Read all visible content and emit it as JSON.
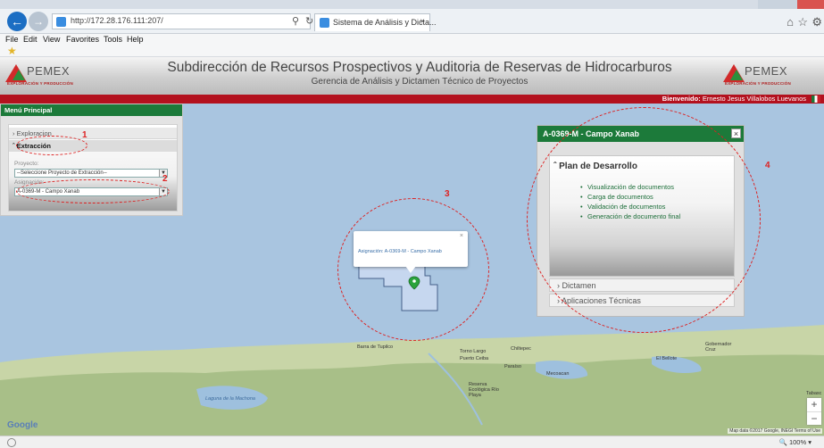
{
  "browser": {
    "url": "http://172.28.176.111:207/",
    "tab_title": "Sistema de Análisis y Dicta...",
    "menu": [
      "File",
      "Edit",
      "View",
      "Favorites",
      "Tools",
      "Help"
    ]
  },
  "header": {
    "logo_name": "PEMEX",
    "logo_sub": "EXPLORACIÓN Y PRODUCCIÓN",
    "title": "Subdirección de Recursos Prospectivos y Auditoria de Reservas de Hidrocarburos",
    "subtitle": "Gerencia de Análisis y Dictamen Técnico de Proyectos"
  },
  "welcome": {
    "label": "Bienvenido:",
    "user": "Ernesto Jesus Villalobos Luevanos"
  },
  "left_menu": {
    "title": "Menú Principal",
    "items": [
      {
        "label": "Exploracion"
      },
      {
        "label": "Extracción"
      }
    ],
    "proyecto_label": "Proyecto:",
    "proyecto_value": "--Seleccione Proyecto de Extracción--",
    "asignacion_label": "Asignación:",
    "asignacion_value": "A-0369-M - Campo Xanab"
  },
  "map_popup": {
    "text": "Asignación: A-0369-M - Campo Xanab"
  },
  "campo_panel": {
    "title": "A-0369-M - Campo Xanab",
    "section": "Plan de Desarrollo",
    "links": [
      "Visualización de documentos",
      "Carga de documentos",
      "Validación de documentos",
      "Generación de documento final"
    ],
    "dictamen": "Dictamen",
    "aplicaciones": "Aplicaciones Técnicas"
  },
  "callouts": [
    "1",
    "2",
    "3",
    "4"
  ],
  "map_places": [
    {
      "label": "Barra de Tupilco"
    },
    {
      "label": "Torno Largo"
    },
    {
      "label": "Chiltepec"
    },
    {
      "label": "Puerto Ceiba"
    },
    {
      "label": "Paraíso"
    },
    {
      "label": "Mecoacan"
    },
    {
      "label": "El Bellote"
    },
    {
      "label": "Reserva Ecológica Río Playa"
    },
    {
      "label": "Laguna de la Machona"
    },
    {
      "label": "Gobernador Cruz"
    },
    {
      "label": "Tabasc"
    }
  ],
  "map_footer": "Map data ©2017 Google, INEGI   Terms of Use",
  "google_label": "Google",
  "status": {
    "zoom": "100%"
  },
  "icons": {
    "back": "back-arrow-icon",
    "forward": "forward-arrow-icon",
    "home": "home-icon",
    "favorites": "star-icon",
    "tools": "gear-icon"
  },
  "colors": {
    "pemex_green": "#1c7a3a",
    "pemex_red": "#b3111e",
    "sea": "#a9c5e0",
    "callout": "#dd2222"
  }
}
